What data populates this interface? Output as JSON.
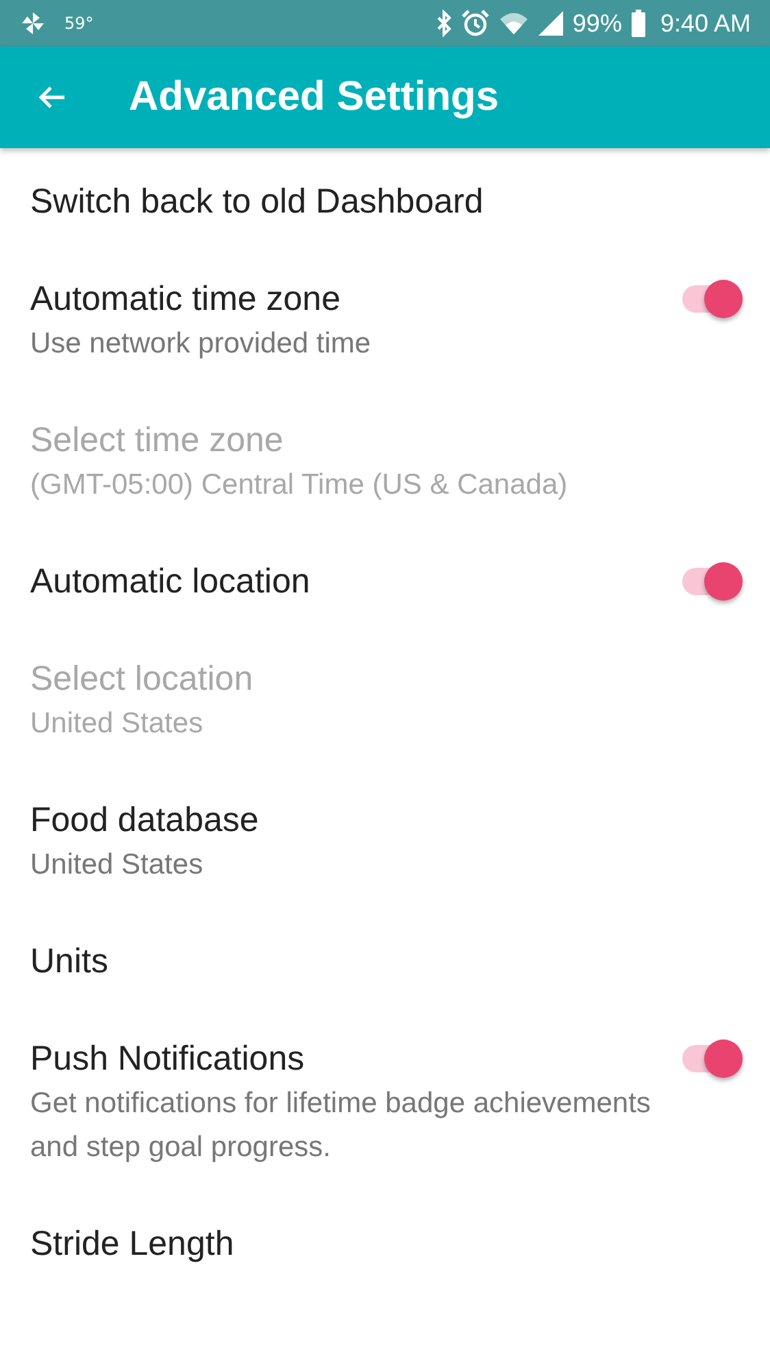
{
  "status_bar": {
    "temperature": "59°",
    "battery": "99%",
    "time": "9:40 AM"
  },
  "app_bar": {
    "title": "Advanced Settings"
  },
  "settings": [
    {
      "kind": "plain",
      "title": "Switch back to old Dashboard",
      "disabled": false
    },
    {
      "kind": "toggle",
      "title": "Automatic time zone",
      "subtitle": "Use network provided time",
      "disabled": false,
      "on": true
    },
    {
      "kind": "plain",
      "title": "Select time zone",
      "subtitle": "(GMT-05:00) Central Time (US & Canada)",
      "disabled": true
    },
    {
      "kind": "toggle",
      "title": "Automatic location",
      "disabled": false,
      "on": true
    },
    {
      "kind": "plain",
      "title": "Select location",
      "subtitle": "United States",
      "disabled": true
    },
    {
      "kind": "plain",
      "title": "Food database",
      "subtitle": "United States",
      "disabled": false
    },
    {
      "kind": "plain",
      "title": "Units",
      "disabled": false
    },
    {
      "kind": "toggle",
      "title": "Push Notifications",
      "subtitle": "Get notifications for lifetime badge achievements and step goal progress.",
      "disabled": false,
      "on": true
    },
    {
      "kind": "plain",
      "title": "Stride Length",
      "disabled": false
    }
  ]
}
